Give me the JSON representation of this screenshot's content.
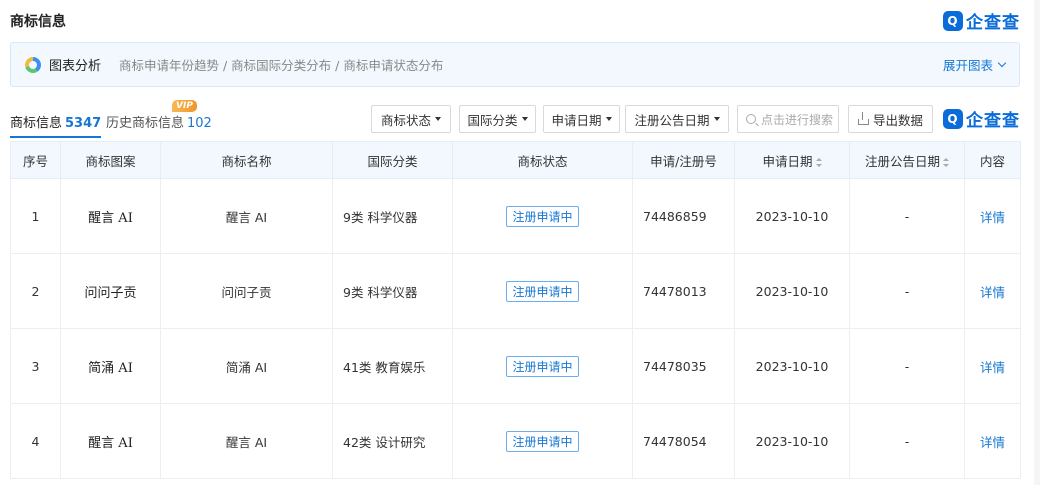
{
  "header": {
    "title": "商标信息",
    "brand": "企查查",
    "brand_mark": "Q"
  },
  "chart_panel": {
    "label": "图表分析",
    "description": "商标申请年份趋势 / 商标国际分类分布 / 商标申请状态分布",
    "expand": "展开图表"
  },
  "tabs": [
    {
      "label": "商标信息",
      "count": "5347"
    },
    {
      "label": "历史商标信息",
      "count": "102",
      "badge": "VIP"
    }
  ],
  "filters": [
    "商标状态",
    "国际分类",
    "申请日期",
    "注册公告日期"
  ],
  "search": {
    "placeholder": "点击进行搜索"
  },
  "export": {
    "label": "导出数据"
  },
  "table": {
    "columns": [
      "序号",
      "商标图案",
      "商标名称",
      "国际分类",
      "商标状态",
      "申请/注册号",
      "申请日期",
      "注册公告日期",
      "内容"
    ],
    "rows": [
      {
        "no": "1",
        "image_text": "醒言 AI",
        "name": "醒言 AI",
        "class": "9类 科学仪器",
        "status": "注册申请中",
        "reg_no": "74486859",
        "date": "2023-10-10",
        "notice_date": "-",
        "detail": "详情"
      },
      {
        "no": "2",
        "image_text": "问问子贡",
        "name": "问问子贡",
        "class": "9类 科学仪器",
        "status": "注册申请中",
        "reg_no": "74478013",
        "date": "2023-10-10",
        "notice_date": "-",
        "detail": "详情"
      },
      {
        "no": "3",
        "image_text": "简涌 AI",
        "name": "简涌 AI",
        "class": "41类 教育娱乐",
        "status": "注册申请中",
        "reg_no": "74478035",
        "date": "2023-10-10",
        "notice_date": "-",
        "detail": "详情"
      },
      {
        "no": "4",
        "image_text": "醒言 AI",
        "name": "醒言 AI",
        "class": "42类 设计研究",
        "status": "注册申请中",
        "reg_no": "74478054",
        "date": "2023-10-10",
        "notice_date": "-",
        "detail": "详情"
      }
    ]
  }
}
